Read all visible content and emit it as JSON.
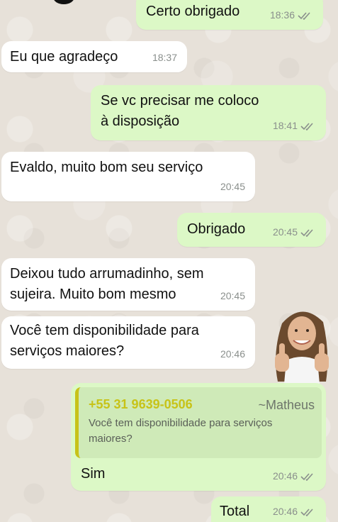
{
  "messages": [
    {
      "text": "Certo obrigado",
      "time": "18:36",
      "dir": "out"
    },
    {
      "text": "Eu que agradeço",
      "time": "18:37",
      "dir": "in"
    },
    {
      "text": "Se vc precisar me coloco à disposição",
      "time": "18:41",
      "dir": "out"
    },
    {
      "text": "Evaldo, muito bom seu serviço",
      "time": "20:45",
      "dir": "in"
    },
    {
      "text": "Obrigado",
      "time": "20:45",
      "dir": "out"
    },
    {
      "text": "Deixou tudo arrumadinho, sem sujeira. Muito bom mesmo",
      "time": "20:45",
      "dir": "in"
    },
    {
      "text": "Você tem disponibilidade para serviços maiores?",
      "time": "20:46",
      "dir": "in"
    },
    {
      "text": "Sim",
      "time": "20:46",
      "dir": "out"
    },
    {
      "text": "Total",
      "time": "20:46",
      "dir": "out"
    }
  ],
  "reply_quote": {
    "phone": "+55 31 9639-0506",
    "name": "~Matheus",
    "text": "Você tem disponibilidade para serviços maiores?"
  },
  "colors": {
    "incoming": "#ffffff",
    "outgoing": "#dcf8c6",
    "quote_accent": "#c7c318",
    "read_ticks": "#8a8f8c"
  },
  "icons": {
    "read_receipt": "double-check-icon",
    "sticker": "thumbs-up-woman-sticker"
  }
}
